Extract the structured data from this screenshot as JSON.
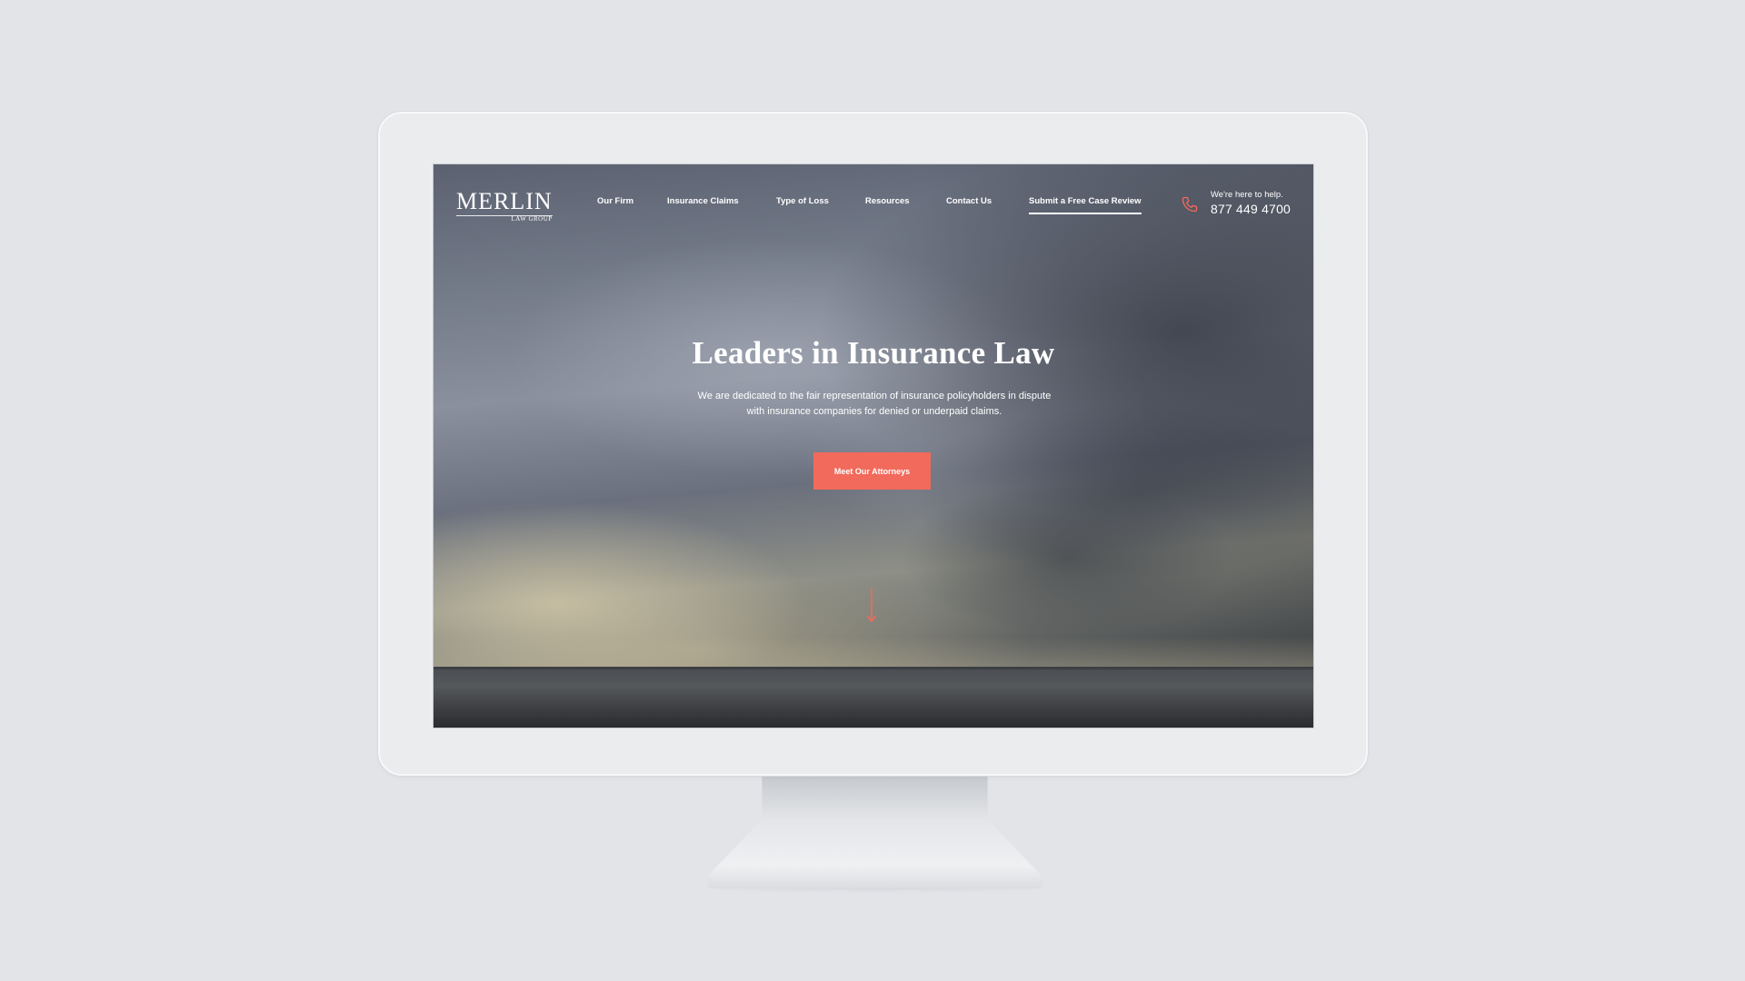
{
  "site": {
    "logo": {
      "main": "MERLIN",
      "sub": "LAW GROUP"
    },
    "nav": [
      {
        "label": "Our Firm"
      },
      {
        "label": "Insurance Claims"
      },
      {
        "label": "Type of Loss"
      },
      {
        "label": "Resources"
      },
      {
        "label": "Contact Us"
      },
      {
        "label": "Submit a Free Case Review",
        "active": true
      }
    ],
    "help": {
      "text": "We're here to help.",
      "number": "877 449 4700",
      "icon": "phone-icon"
    },
    "hero": {
      "title": "Leaders in Insurance Law",
      "text": "We are dedicated to the fair representation of insurance policyholders in dispute with insurance companies for denied or underpaid claims.",
      "cta_label": "Meet Our Attorneys",
      "scroll_icon": "arrow-down-icon"
    }
  },
  "colors": {
    "accent": "#f26a5b",
    "text": "#ffffff",
    "backdrop": "#e2e4e8"
  }
}
